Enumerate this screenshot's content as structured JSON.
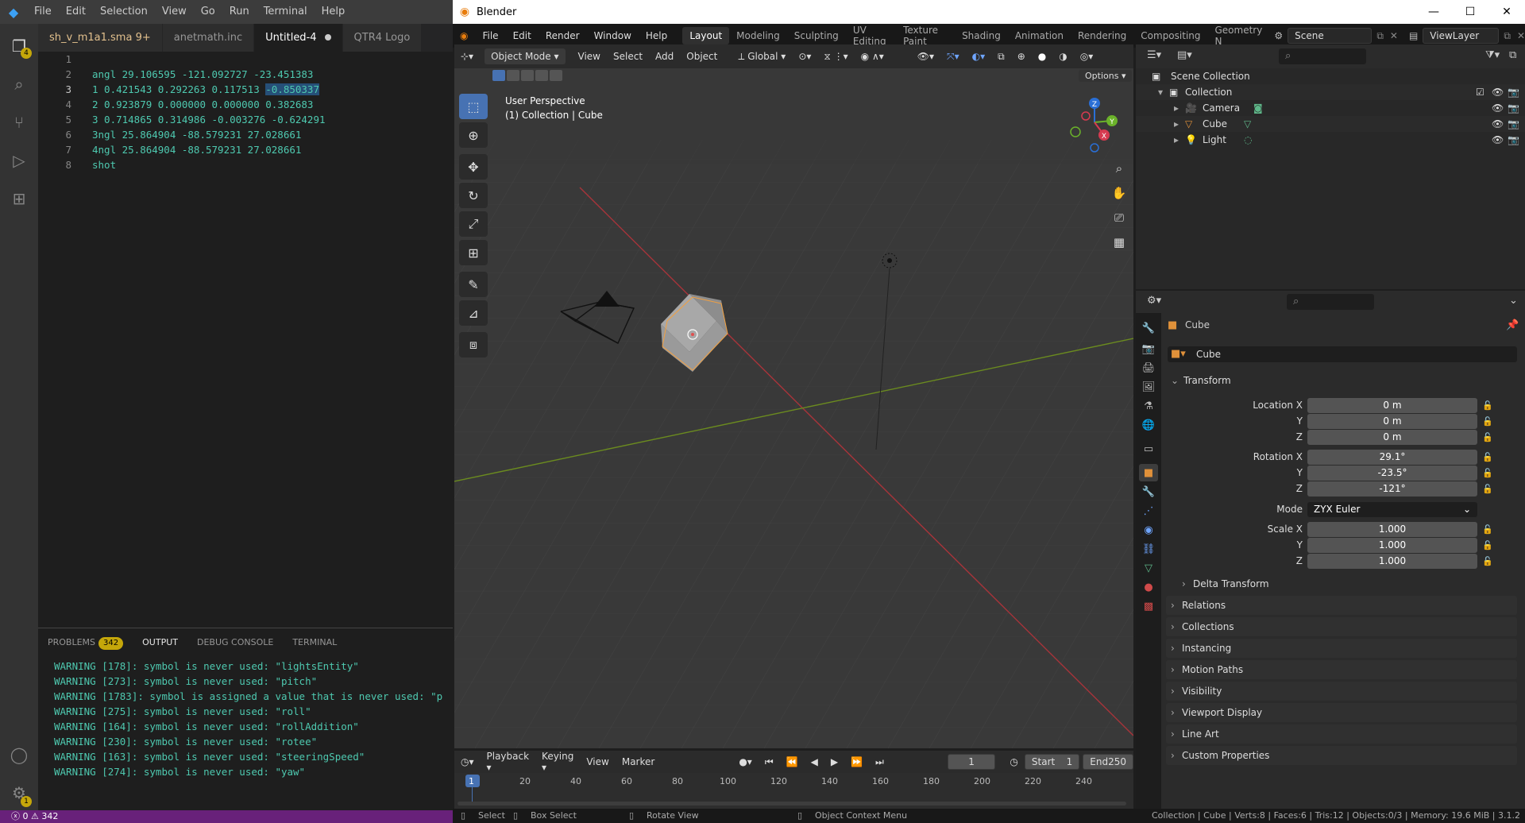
{
  "vscode": {
    "menu": [
      "File",
      "Edit",
      "Selection",
      "View",
      "Go",
      "Run",
      "Terminal",
      "Help"
    ],
    "activity_badges": {
      "explorer": "4",
      "settings": "1"
    },
    "tabs": [
      {
        "label": "sh_v_m1a1.sma",
        "suffix": "9+"
      },
      {
        "label": "anetmath.inc",
        "suffix": ""
      },
      {
        "label": "Untitled-4",
        "suffix": ""
      },
      {
        "label": "QTR4 Logo",
        "suffix": ""
      }
    ],
    "lines": [
      {
        "n": "1",
        "text": ""
      },
      {
        "n": "2",
        "text": "angl 29.106595 -121.092727 -23.451383"
      },
      {
        "n": "3",
        "text": "1 0.421543 0.292263 0.117513 ",
        "sel": "-0.850337"
      },
      {
        "n": "4",
        "text": "2 0.923879 0.000000 0.000000 0.382683"
      },
      {
        "n": "5",
        "text": "3 0.714865 0.314986 -0.003276 -0.624291"
      },
      {
        "n": "6",
        "text": "3ngl 25.864904 -88.579231 27.028661"
      },
      {
        "n": "7",
        "text": "4ngl 25.864904 -88.579231 27.028661"
      },
      {
        "n": "8",
        "text": "shot"
      }
    ],
    "panel_tabs": [
      "PROBLEMS",
      "OUTPUT",
      "DEBUG CONSOLE",
      "TERMINAL"
    ],
    "problems_count": "342",
    "output": [
      "WARNING [178]: symbol is never used: \"lightsEntity\"",
      "WARNING [273]: symbol is never used: \"pitch\"",
      "WARNING [1783]: symbol is assigned a value that is never used: \"p",
      "WARNING [275]: symbol is never used: \"roll\"",
      "WARNING [164]: symbol is never used: \"rollAddition\"",
      "WARNING [230]: symbol is never used: \"rotee\"",
      "WARNING [163]: symbol is never used: \"steeringSpeed\"",
      "WARNING [274]: symbol is never used: \"yaw\""
    ],
    "status": "ⓧ 0 ⚠ 342"
  },
  "blender": {
    "title": "Blender",
    "menu": [
      "File",
      "Edit",
      "Render",
      "Window",
      "Help"
    ],
    "workspaces": [
      "Layout",
      "Modeling",
      "Sculpting",
      "UV Editing",
      "Texture Paint",
      "Shading",
      "Animation",
      "Rendering",
      "Compositing",
      "Geometry N"
    ],
    "scene": "Scene",
    "view_layer": "ViewLayer",
    "header": {
      "mode": "Object Mode",
      "menus": [
        "View",
        "Select",
        "Add",
        "Object"
      ],
      "orientation": "Global",
      "options": "Options"
    },
    "viewport_text": {
      "line1": "User Perspective",
      "line2": "(1) Collection | Cube"
    },
    "gizmo_labels": {
      "x": "X",
      "y": "Y",
      "z": "Z"
    },
    "outliner": [
      {
        "label": "Scene Collection"
      },
      {
        "label": "Collection"
      },
      {
        "label": "Camera"
      },
      {
        "label": "Cube"
      },
      {
        "label": "Light"
      }
    ],
    "properties": {
      "object_name": "Cube",
      "data_name": "Cube",
      "transform_title": "Transform",
      "fields": [
        {
          "label": "Location X",
          "value": "0 m"
        },
        {
          "label": "Y",
          "value": "0 m"
        },
        {
          "label": "Z",
          "value": "0 m"
        },
        {
          "label": "Rotation X",
          "value": "29.1°"
        },
        {
          "label": "Y",
          "value": "-23.5°"
        },
        {
          "label": "Z",
          "value": "-121°"
        }
      ],
      "mode_label": "Mode",
      "mode_value": "ZYX Euler",
      "scale": [
        {
          "label": "Scale X",
          "value": "1.000"
        },
        {
          "label": "Y",
          "value": "1.000"
        },
        {
          "label": "Z",
          "value": "1.000"
        }
      ],
      "delta": "Delta Transform",
      "panels": [
        "Relations",
        "Collections",
        "Instancing",
        "Motion Paths",
        "Visibility",
        "Viewport Display",
        "Line Art",
        "Custom Properties"
      ]
    },
    "timeline": {
      "menus": [
        "Playback",
        "Keying",
        "View",
        "Marker"
      ],
      "current": "1",
      "start_label": "Start",
      "start": "1",
      "end_label": "End",
      "end": "250",
      "ticks": [
        "1",
        "20",
        "40",
        "60",
        "80",
        "100",
        "120",
        "140",
        "160",
        "180",
        "200",
        "220",
        "240"
      ]
    },
    "status": {
      "select": "Select",
      "box_select": "Box Select",
      "rotate": "Rotate View",
      "context": "Object Context Menu",
      "info": "Collection | Cube | Verts:8 | Faces:6 | Tris:12 | Objects:0/3 | Memory: 19.6 MiB | 3.1.2"
    }
  }
}
